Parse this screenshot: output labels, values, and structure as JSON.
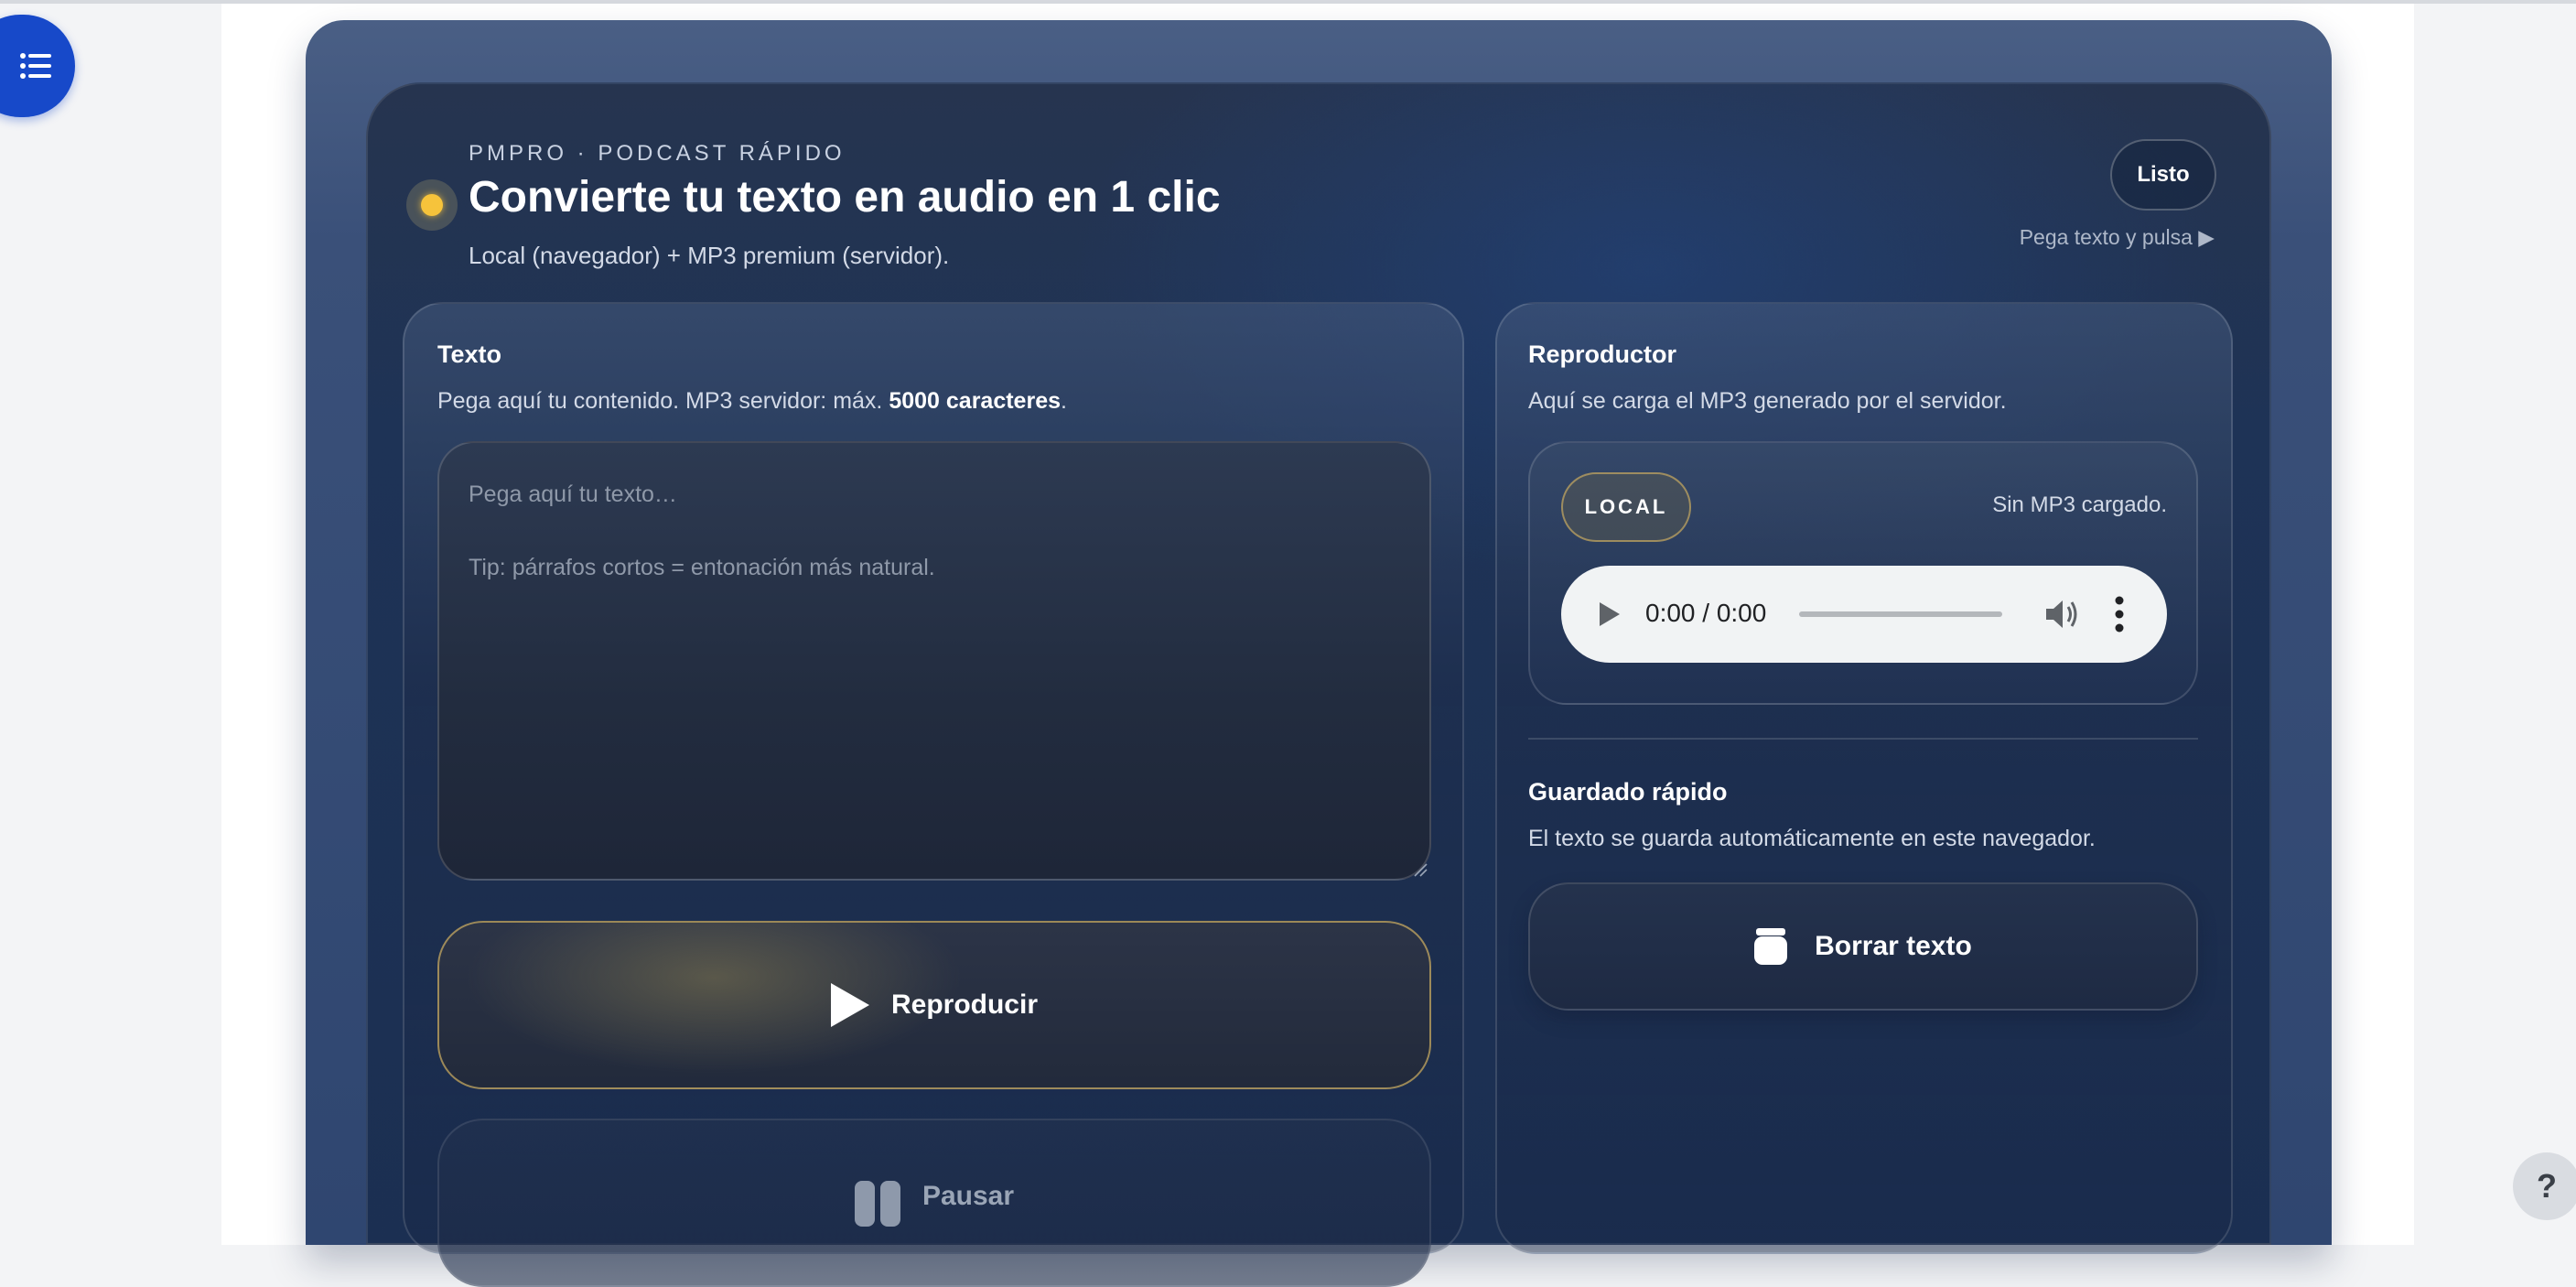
{
  "header": {
    "eyebrow": "PMPRO · PODCAST RÁPIDO",
    "title": "Convierte tu texto en audio en 1 clic",
    "subtitle": "Local (navegador) + MP3 premium (servidor).",
    "status_badge": "Listo",
    "hint": "Pega texto y pulsa ▶"
  },
  "text_panel": {
    "title": "Texto",
    "desc_prefix": "Pega aquí tu contenido. MP3 servidor: máx. ",
    "desc_bold": "5000 caracteres",
    "desc_suffix": ".",
    "textarea_value": "",
    "textarea_placeholder": "Pega aquí tu texto…\n\nTip: párrafos cortos = entonación más natural.",
    "play_label": "Reproducir",
    "pause_label": "Pausar"
  },
  "player_panel": {
    "title": "Reproductor",
    "desc": "Aquí se carga el MP3 generado por el servidor.",
    "mode_badge": "LOCAL",
    "mp3_status": "Sin MP3 cargado.",
    "audio_time": "0:00 / 0:00",
    "progress": 0
  },
  "save_panel": {
    "title": "Guardado rápido",
    "desc": "El texto se guarda automáticamente en este navegador.",
    "clear_label": "Borrar texto"
  },
  "help_label": "?",
  "colors": {
    "accent_blue": "#1749c9",
    "status_yellow": "#f6c33b",
    "gold_border": "#c4a862"
  }
}
